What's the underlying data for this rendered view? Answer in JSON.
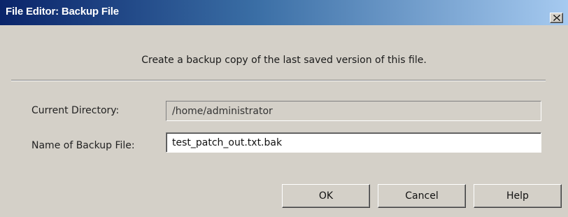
{
  "window": {
    "title": "File Editor: Backup File"
  },
  "description": "Create a backup copy of the last saved version of this file.",
  "form": {
    "current_directory": {
      "label": "Current Directory:",
      "value": "/home/administrator"
    },
    "backup_name": {
      "label": "Name of Backup File:",
      "value": "test_patch_out.txt.bak"
    }
  },
  "buttons": {
    "ok": "OK",
    "cancel": "Cancel",
    "help": "Help"
  },
  "colors": {
    "titlebar_start": "#0a246a",
    "titlebar_end": "#a6caf0",
    "dialog_bg": "#d4d0c8"
  },
  "icons": {
    "close": "close-icon"
  }
}
